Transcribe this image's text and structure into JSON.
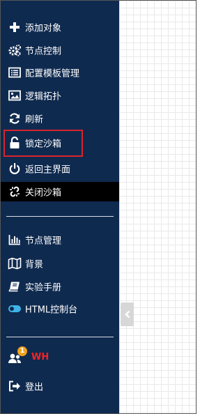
{
  "colors": {
    "sidebar_bg": "#0f2a4f",
    "active_bg": "#000000",
    "highlight_border": "#d9232d",
    "user_name": "#ff2020",
    "badge": "#f0a11d",
    "toggle_on": "#3fb3e8",
    "canvas_grid": "#e9e9e9"
  },
  "menu": {
    "add_object": {
      "label": "添加对象",
      "icon": "plus-icon"
    },
    "node_control": {
      "label": "节点控制",
      "icon": "gears-icon"
    },
    "config_template": {
      "label": "配置模板管理",
      "icon": "list-box-icon"
    },
    "logical_topology": {
      "label": "逻辑拓扑",
      "icon": "image-icon"
    },
    "refresh": {
      "label": "刷新",
      "icon": "refresh-icon"
    },
    "lock_sandbox": {
      "label": "锁定沙箱",
      "icon": "unlock-icon"
    },
    "return_main": {
      "label": "返回主界面",
      "icon": "power-icon"
    },
    "close_sandbox": {
      "label": "关闭沙箱",
      "icon": "unlink-icon"
    }
  },
  "menu2": {
    "node_management": {
      "label": "节点管理",
      "icon": "bar-chart-icon"
    },
    "background": {
      "label": "背景",
      "icon": "map-icon"
    },
    "lab_manual": {
      "label": "实验手册",
      "icon": "book-icon"
    },
    "html_console": {
      "label": "HTML控制台",
      "icon": "toggle-on-icon",
      "enabled": true
    }
  },
  "user": {
    "name": "WH",
    "badge_count": "1",
    "icon": "users-icon"
  },
  "logout": {
    "label": "登出",
    "icon": "sign-out-icon"
  },
  "collapse": {
    "icon": "chevron-left-icon"
  }
}
